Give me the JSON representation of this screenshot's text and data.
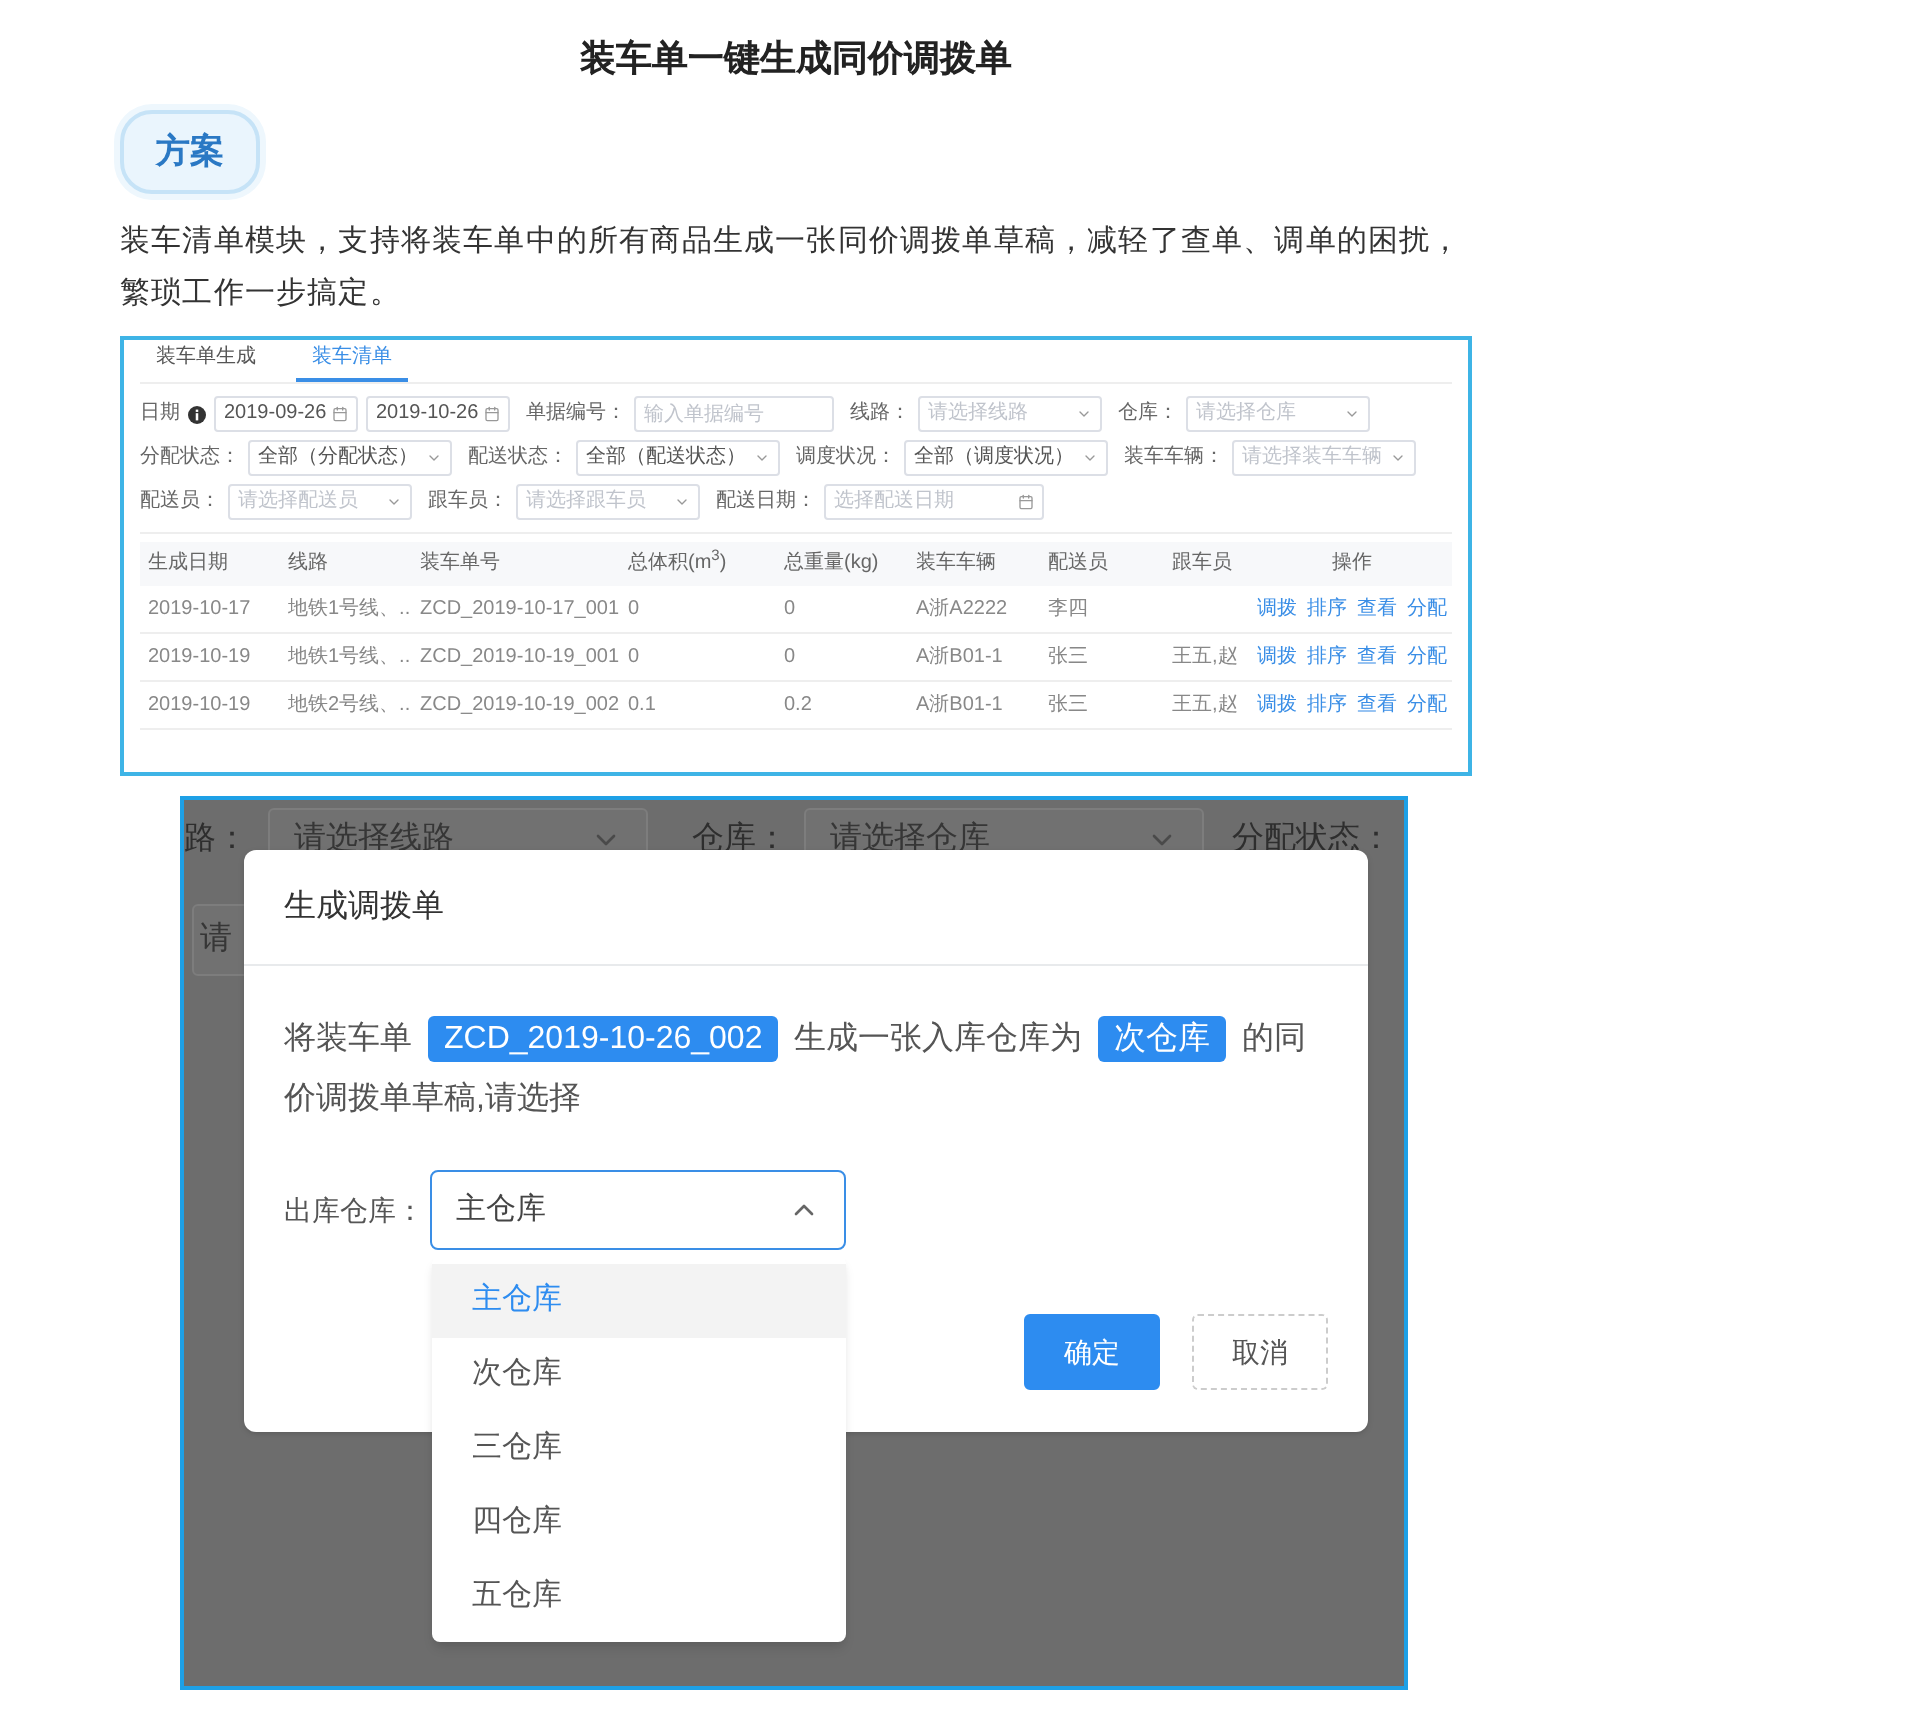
{
  "article": {
    "title": "装车单一键生成同价调拨单",
    "badge": "方案",
    "description": "装车清单模块，支持将装车单中的所有商品生成一张同价调拨单草稿，减轻了查单、调单的困扰，繁琐工作一步搞定。"
  },
  "list_screen": {
    "tabs": [
      {
        "label": "装车单生成",
        "selected": false
      },
      {
        "label": "装车清单",
        "selected": true
      }
    ],
    "filter_rows": [
      {
        "fields": [
          {
            "kind": "dates",
            "label": "日期",
            "info": true,
            "values": [
              "2019-09-26",
              "2019-10-26"
            ]
          },
          {
            "kind": "input",
            "label": "单据编号：",
            "placeholder": "输入单据编号"
          },
          {
            "kind": "select",
            "label": "线路：",
            "placeholder": "请选择线路"
          },
          {
            "kind": "select",
            "label": "仓库：",
            "placeholder": "请选择仓库"
          }
        ]
      },
      {
        "fields": [
          {
            "kind": "select",
            "label": "分配状态：",
            "value": "全部（分配状态）"
          },
          {
            "kind": "select",
            "label": "配送状态：",
            "value": "全部（配送状态）"
          },
          {
            "kind": "select",
            "label": "调度状况：",
            "value": "全部（调度状况）"
          },
          {
            "kind": "select",
            "label": "装车车辆：",
            "placeholder": "请选择装车车辆"
          }
        ]
      },
      {
        "fields": [
          {
            "kind": "select",
            "label": "配送员：",
            "placeholder": "请选择配送员"
          },
          {
            "kind": "select",
            "label": "跟车员：",
            "placeholder": "请选择跟车员"
          },
          {
            "kind": "date",
            "label": "配送日期：",
            "placeholder": "选择配送日期"
          }
        ]
      }
    ],
    "table": {
      "columns": [
        "生成日期",
        "线路",
        "装车单号",
        "总体积(m$^{3}$)",
        "总重量(kg)",
        "装车车辆",
        "配送员",
        "跟车员",
        "操作"
      ],
      "rows": [
        {
          "cells": [
            "2019-10-17",
            "地铁1号线、...",
            "ZCD_2019-10-17_001",
            "0",
            "0",
            "A浙A2222",
            "李四",
            null
          ],
          "actions": [
            "调拨",
            "排序",
            "查看",
            "分配"
          ]
        },
        {
          "cells": [
            "2019-10-19",
            "地铁1号线、...",
            "ZCD_2019-10-19_001",
            "0",
            "0",
            "A浙B01-1",
            "张三",
            "王五,赵"
          ],
          "actions": [
            "调拨",
            "排序",
            "查看",
            "分配"
          ]
        },
        {
          "cells": [
            "2019-10-19",
            "地铁2号线、...",
            "ZCD_2019-10-19_002",
            "0.1",
            "0.2",
            "A浙B01-1",
            "张三",
            "王五,赵"
          ],
          "actions": [
            "调拨",
            "排序",
            "查看",
            "分配"
          ]
        }
      ]
    }
  },
  "dialog_screen": {
    "background_fields": [
      {
        "label": "路：",
        "placeholder": "请选择线路"
      },
      {
        "label": "仓库：",
        "placeholder": "请选择仓库"
      }
    ],
    "background_label": "分配状态：",
    "background_input": "请",
    "dialog": {
      "title": "生成调拨单",
      "message": [
        {
          "kind": "text",
          "text": "将装车单"
        },
        {
          "kind": "tag",
          "text": "ZCD_2019-10-26_002"
        },
        {
          "kind": "text",
          "text": "生成一张入库仓库为"
        },
        {
          "kind": "tag",
          "text": "次仓库"
        },
        {
          "kind": "text",
          "text": "的同价调拨单草稿,请选择"
        }
      ],
      "field_label": "出库仓库：",
      "value": "主仓库",
      "expanded": true,
      "options": [
        {
          "label": "主仓库",
          "selected": true
        },
        {
          "label": "次仓库",
          "selected": false
        },
        {
          "label": "三仓库",
          "selected": false
        },
        {
          "label": "四仓库",
          "selected": false
        },
        {
          "label": "五仓库",
          "selected": false
        }
      ],
      "buttons": [
        {
          "label": "确定",
          "kind": "primary"
        },
        {
          "label": "取消",
          "kind": "default"
        }
      ]
    }
  }
}
